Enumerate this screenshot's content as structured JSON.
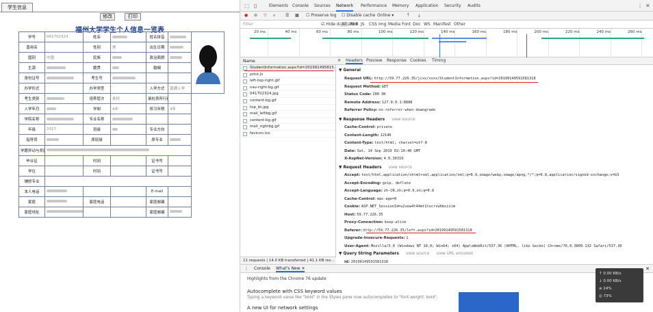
{
  "student_page": {
    "tab": "学生信息",
    "buttons": {
      "edit": "修改",
      "print": "打印"
    },
    "title": "福州大学学生个人信息一览表",
    "rows": [
      [
        {
          "t": "学号"
        },
        {
          "t": "041702324",
          "v": 1
        },
        {
          "t": "姓名"
        },
        {
          "b": 22
        },
        {
          "t": "姓名拼音"
        },
        {
          "b": 24
        }
      ],
      [
        {
          "t": "曾用名"
        },
        {
          "t": ""
        },
        {
          "t": "性别"
        },
        {
          "t": "男"
        },
        {
          "t": "出生日期"
        },
        {
          "b": 20
        }
      ],
      [
        {
          "t": "国别"
        },
        {
          "t": "中国"
        },
        {
          "t": "民族"
        },
        {
          "b": 14
        },
        {
          "t": "政治面貌"
        },
        {
          "b": 18
        }
      ],
      [
        {
          "t": "生源"
        },
        {
          "b": 28
        },
        {
          "t": "籍贯"
        },
        {
          "b": 10
        },
        {
          "t": "婚姻"
        },
        {
          "t": ""
        }
      ],
      [
        {
          "t": "身份证号"
        },
        {
          "b": 40
        },
        {
          "t": "考生号"
        },
        {
          "b": 34
        },
        {
          "t": ""
        },
        {
          "t": ""
        }
      ],
      [
        {
          "t": "办学形式"
        },
        {
          "t": ""
        },
        {
          "t": "办学类型"
        },
        {
          "t": ""
        },
        {
          "t": "入学方式"
        },
        {
          "t": "普通入学"
        }
      ],
      [
        {
          "t": "考生类别"
        },
        {
          "b": 26
        },
        {
          "t": "培养层次"
        },
        {
          "t": "本科"
        },
        {
          "t": "录检表所行行"
        },
        {
          "t": ""
        }
      ],
      [
        {
          "t": "入学年月"
        },
        {
          "b": 14
        },
        {
          "t": "学制"
        },
        {
          "t": "4年"
        },
        {
          "t": "修习年限"
        },
        {
          "t": "4年"
        }
      ],
      [
        {
          "t": "学院名称"
        },
        {
          "b": 40
        },
        {
          "t": "专业名称"
        },
        {
          "b": 30
        },
        {
          "t": ""
        },
        {
          "t": ""
        }
      ],
      [
        {
          "t": "年级"
        },
        {
          "t": "2017",
          "v": 1
        },
        {
          "t": "班级"
        },
        {
          "b": 8
        },
        {
          "t": "专业方向"
        },
        {
          "t": ""
        }
      ],
      [
        {
          "t": "指导员"
        },
        {
          "b": 18
        },
        {
          "t": "原班级"
        },
        {
          "t": ""
        },
        {
          "t": "原专业"
        },
        {
          "b": 16
        }
      ],
      [
        {
          "t": "学籍异动与奖励"
        },
        {
          "b": 150,
          "span": 5
        }
      ],
      [
        {
          "t": "毕业证"
        },
        {
          "t": ""
        },
        {
          "t": "时间"
        },
        {
          "t": ""
        },
        {
          "t": "证书号"
        },
        {
          "t": ""
        }
      ],
      [
        {
          "t": "学位"
        },
        {
          "t": ""
        },
        {
          "t": "时间"
        },
        {
          "t": ""
        },
        {
          "t": "证书号"
        },
        {
          "t": ""
        }
      ],
      [
        {
          "t": "辅修专业"
        },
        {
          "t": "",
          "span": 5
        }
      ],
      [
        {
          "t": "本人电话"
        },
        {
          "b": 30
        },
        {
          "t": ""
        },
        {
          "t": ""
        },
        {
          "t": "E-mail"
        },
        {
          "t": ""
        }
      ],
      [
        {
          "t": "家庭"
        },
        {
          "b": 30
        },
        {
          "t": "家庭电话"
        },
        {
          "t": ""
        },
        {
          "t": "家庭邮编"
        },
        {
          "t": ""
        }
      ],
      [
        {
          "t": "家庭地址"
        },
        {
          "b": 60
        },
        {
          "t": ""
        },
        {
          "t": ""
        },
        {
          "t": "家庭邮编"
        },
        {
          "b": 18
        }
      ]
    ]
  },
  "devtools": {
    "tabs": [
      "Elements",
      "Console",
      "Sources",
      "Network",
      "Performance",
      "Memory",
      "Application",
      "Security",
      "Audits"
    ],
    "active_tab": "Network",
    "toolbar": {
      "preserve_log": "Preserve log",
      "disable_cache": "Disable cache",
      "online": "Online"
    },
    "filter": {
      "placeholder": "Filter",
      "hide_data_urls": "Hide data URLs",
      "types": [
        "All",
        "XHR",
        "JS",
        "CSS",
        "Img",
        "Media",
        "Font",
        "Doc",
        "WS",
        "Manifest",
        "Other"
      ]
    },
    "ticks": [
      "20 ms",
      "40 ms",
      "60 ms",
      "80 ms",
      "100 ms",
      "120 ms",
      "140 ms",
      "160 ms",
      "180 ms",
      "200 ms",
      "220 ms",
      "240 ms",
      "260 ms"
    ],
    "list_header": "Name",
    "files": [
      "StudentInformation.aspx?id=201991495815...",
      "print.js",
      "left-top-right.gif",
      "nav-right-bg.gif",
      "041702324.jpg",
      "content-bg.gif",
      "top_bt.jpg",
      "mail_leftbg.gif",
      "content-bg.gif",
      "mail_rightbg.gif",
      "favicon.ico"
    ],
    "status_bar": "11 requests | 14.0 KB transferred | 41.1 KB res...",
    "detail_tabs": [
      "Headers",
      "Preview",
      "Response",
      "Cookies",
      "Timing"
    ],
    "general": {
      "title": "General",
      "rows": [
        {
          "k": "Request URL:",
          "v": "http://59.77.226.35/jcxx/xsxx/StudentInformation.aspx?id=20199149591581318"
        },
        {
          "k": "Request Method:",
          "v": "GET"
        },
        {
          "k": "Status Code:",
          "v": "200 OK"
        },
        {
          "k": "Remote Address:",
          "v": "127.0.0.1:8888"
        },
        {
          "k": "Referrer Policy:",
          "v": "no-referrer-when-downgrade"
        }
      ]
    },
    "response_headers": {
      "title": "Response Headers",
      "view_source": "view source",
      "rows": [
        {
          "k": "Cache-Control:",
          "v": "private"
        },
        {
          "k": "Content-Length:",
          "v": "12140"
        },
        {
          "k": "Content-Type:",
          "v": "text/html; charset=utf-8"
        },
        {
          "k": "Date:",
          "v": "Sat, 14 Sep 2019 02:10:40 GMT"
        },
        {
          "k": "X-AspNet-Version:",
          "v": "4.0.30319"
        }
      ]
    },
    "request_headers": {
      "title": "Request Headers",
      "view_source": "view source",
      "rows": [
        {
          "k": "Accept:",
          "v": "text/html,application/xhtml+xml,application/xml;q=0.9,image/webp,image/apng,*/*;q=0.8,application/signed-exchange;v=b3"
        },
        {
          "k": "Accept-Encoding:",
          "v": "gzip, deflate"
        },
        {
          "k": "Accept-Language:",
          "v": "zh-CN,zh;q=0.9,en;q=0.8"
        },
        {
          "k": "Cache-Control:",
          "v": "max-age=0"
        },
        {
          "k": "Cookie:",
          "v": "ASP.NET_SessionId=u2vew4t44mt1tocrswhbxisim"
        },
        {
          "k": "Host:",
          "v": "59.77.226.35"
        },
        {
          "k": "Proxy-Connection:",
          "v": "keep-alive"
        },
        {
          "k": "Referer:",
          "v": "http://59.77.226.35/left.aspx?id=20199149591581318"
        },
        {
          "k": "Upgrade-Insecure-Requests:",
          "v": "1"
        },
        {
          "k": "User-Agent:",
          "v": "Mozilla/5.0 (Windows NT 10.0; Win64; x64) AppleWebKit/537.36 (KHTML, like Gecko) Chrome/76.0.3809.132 Safari/537.36"
        }
      ]
    },
    "query": {
      "title": "Query String Parameters",
      "view_source": "view source",
      "view_url_encoded": "view URL encoded",
      "row": {
        "k": "id:",
        "v": "20199149591581318"
      }
    },
    "drawer": {
      "tabs": [
        "Console",
        "What's New"
      ],
      "highlights": "Highlights from the Chrome 76 update",
      "autocomplete_title": "Autocomplete with CSS keyword values",
      "autocomplete_desc": "Typing a keyword value like \"bold\" in the Styles pane now autocompletes to \"font-weight: bold\".",
      "new_ui": "A new UI for network settings"
    },
    "perf_overlay": [
      "0.00 KB/s",
      "0.00 KB/s",
      "24%",
      "73%"
    ]
  }
}
